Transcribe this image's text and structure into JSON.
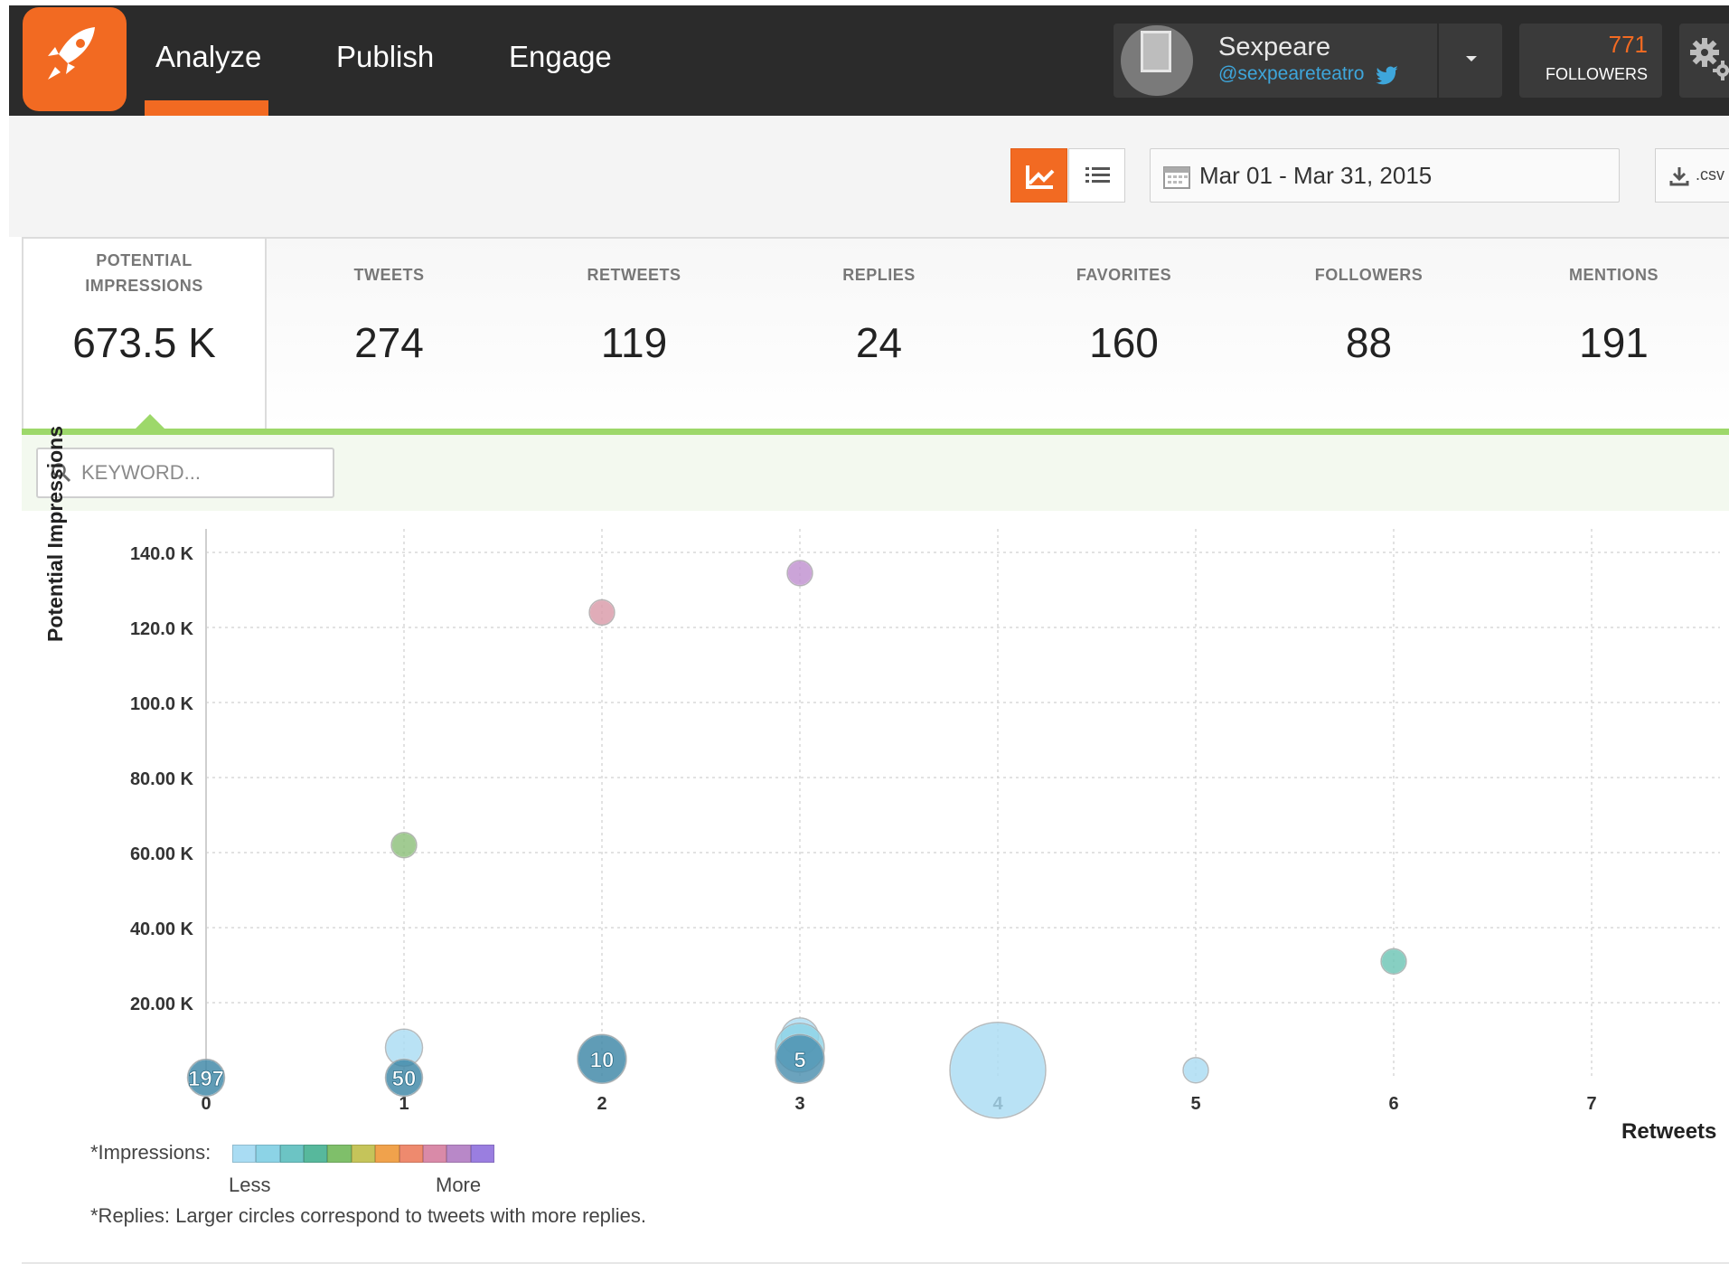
{
  "nav": {
    "tabs": [
      {
        "label": "Analyze",
        "active": true
      },
      {
        "label": "Publish",
        "active": false
      },
      {
        "label": "Engage",
        "active": false
      }
    ]
  },
  "profile": {
    "name": "Sexpeare",
    "handle": "@sexpeareteatro"
  },
  "followers": {
    "count": "771",
    "label": "FOLLOWERS"
  },
  "toolbar": {
    "date_range": "Mar 01 - Mar 31, 2015",
    "csv_label": ".csv"
  },
  "metrics": [
    {
      "label_line1": "POTENTIAL",
      "label_line2": "IMPRESSIONS",
      "value": "673.5 K",
      "active": true
    },
    {
      "label_line1": "TWEETS",
      "value": "274"
    },
    {
      "label_line1": "RETWEETS",
      "value": "119"
    },
    {
      "label_line1": "REPLIES",
      "value": "24"
    },
    {
      "label_line1": "FAVORITES",
      "value": "160"
    },
    {
      "label_line1": "FOLLOWERS",
      "value": "88"
    },
    {
      "label_line1": "MENTIONS",
      "value": "191"
    }
  ],
  "filter": {
    "keyword_placeholder": "KEYWORD..."
  },
  "legend": {
    "impressions_label": "*Impressions:",
    "less": "Less",
    "more": "More",
    "replies_note": "*Replies: Larger circles correspond to tweets with more replies.",
    "scale_colors": [
      "#a9dcf3",
      "#8cd3e6",
      "#6cc4c4",
      "#57b89c",
      "#7fbf6a",
      "#c5c45a",
      "#f0a24c",
      "#ee8a6e",
      "#d98aa8",
      "#b888c8",
      "#9a7ee0"
    ]
  },
  "colors": {
    "accent": "#f26a22",
    "topbar": "#2b2b2b",
    "green_bar": "#9dd86a"
  },
  "chart_data": {
    "type": "scatter",
    "xlabel": "Retweets",
    "ylabel": "Potential Impressions",
    "xlim": [
      0,
      7.5
    ],
    "ylim": [
      0,
      145000
    ],
    "x_ticks": [
      0,
      1,
      2,
      3,
      4,
      5,
      6,
      7
    ],
    "y_ticks": [
      20000,
      40000,
      60000,
      80000,
      100000,
      120000,
      140000
    ],
    "y_tick_labels": [
      "20.00 K",
      "40.00 K",
      "60.00 K",
      "80.00 K",
      "100.0 K",
      "120.0 K",
      "140.0 K"
    ],
    "grid": true,
    "points": [
      {
        "x": 0,
        "y": 0,
        "replies": 1,
        "count_label": "197",
        "color": "#3d86a6"
      },
      {
        "x": 1,
        "y": 8000,
        "replies": 1,
        "color": "#a9dcf3"
      },
      {
        "x": 1,
        "y": 0,
        "replies": 1,
        "count_label": "50",
        "color": "#3d86a6"
      },
      {
        "x": 1,
        "y": 62000,
        "replies": 0,
        "color": "#8cbf7a"
      },
      {
        "x": 2,
        "y": 5000,
        "replies": 2,
        "count_label": "10",
        "color": "#3d86a6"
      },
      {
        "x": 2,
        "y": 124000,
        "replies": 0,
        "color": "#d99aa8"
      },
      {
        "x": 3,
        "y": 11000,
        "replies": 1,
        "color": "#a9dcf3"
      },
      {
        "x": 3,
        "y": 8000,
        "replies": 2,
        "color": "#8cd3e6"
      },
      {
        "x": 3,
        "y": 5000,
        "replies": 2,
        "count_label": "5",
        "color": "#4a8fae"
      },
      {
        "x": 3,
        "y": 134500,
        "replies": 0,
        "color": "#c090cf"
      },
      {
        "x": 4,
        "y": 2000,
        "replies": 6,
        "color": "#a9dcf3"
      },
      {
        "x": 5,
        "y": 2000,
        "replies": 0,
        "color": "#a9dcf3"
      },
      {
        "x": 6,
        "y": 31000,
        "replies": 0,
        "color": "#6cc4b4"
      }
    ]
  }
}
